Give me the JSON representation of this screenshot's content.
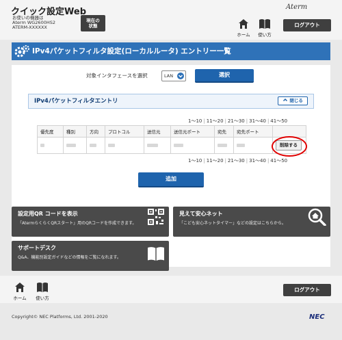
{
  "header": {
    "title": "クイック設定Web",
    "device_caption": "お使いの機器は",
    "model": "Aterm WG2600HS2",
    "ssid": "ATERM-XXXXXX",
    "status_line1": "現在の",
    "status_line2": "状態",
    "brand": "Aterm",
    "home_label": "ホーム",
    "help_label": "使い方",
    "logout_label": "ログアウト"
  },
  "page": {
    "title": "IPv4パケットフィルタ設定(ローカルルータ) エントリー一覧",
    "interface_label": "対象インタフェースを選択",
    "interface_value": "LAN",
    "select_button": "選択"
  },
  "entry": {
    "title": "IPv4パケットフィルタエントリ",
    "close_label": "閉じる",
    "pager": [
      "1～10",
      "11～20",
      "21～30",
      "31～40",
      "41～50"
    ],
    "columns": [
      "優先度",
      "種別",
      "方向",
      "プロトコル",
      "送信元",
      "送信元ポート",
      "宛先",
      "宛先ポート",
      ""
    ],
    "delete_label": "削除する",
    "add_label": "追加"
  },
  "cards": {
    "qr_title": "設定用QR コードを表示",
    "qr_desc": "「AtermらくらくQRスタート」用のQRコードを作成できます。",
    "safe_title": "見えて安心ネット",
    "safe_desc": "「こども安心ネットタイマー」などの設定はこちらから。",
    "support_title": "サポートデスク",
    "support_desc": "Q&A、機能別設定ガイドなどの情報をご覧になれます。"
  },
  "footer": {
    "home_label": "ホーム",
    "help_label": "使い方",
    "logout_label": "ログアウト",
    "copyright": "Copyright© NEC Platforms, Ltd. 2001-2020",
    "nec": "NEC"
  },
  "colors": {
    "accent": "#2f72b8",
    "button_blue": "#1f64ad",
    "dark": "#3f3f3f",
    "highlight_ring": "#e00000"
  },
  "icons": [
    "home-icon",
    "book-icon",
    "gear-icon",
    "chevron-down-icon",
    "chevron-up-icon",
    "qr-code-icon",
    "magnifier-house-icon"
  ]
}
